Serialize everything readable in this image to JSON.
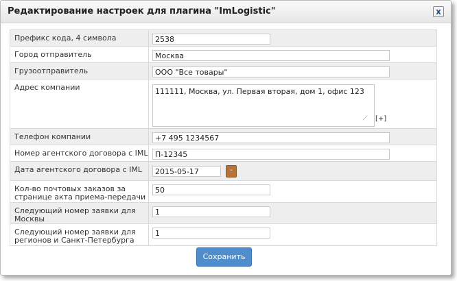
{
  "dialog": {
    "title": "Редактирование настроек для плагина \"ImLogistic\"",
    "close_label": "x"
  },
  "fields": {
    "prefix": {
      "label": "Префикс кода, 4 символа",
      "value": "2538"
    },
    "city": {
      "label": "Город отправитель",
      "value": "Москва"
    },
    "shipper": {
      "label": "Грузоотправитель",
      "value": "ООО \"Все товары\""
    },
    "address": {
      "label": "Адрес компании",
      "value": "111111, Москва, ул. Первая вторая, дом 1, офис 123",
      "expand_label": "[+]"
    },
    "phone": {
      "label": "Телефон компании",
      "value": "+7 495 1234567"
    },
    "contract_number": {
      "label": "Номер агентского договора с IML",
      "value": "П-12345"
    },
    "contract_date": {
      "label": "Дата агентского договора с IML",
      "value": "2015-05-17",
      "calendar_label": "-"
    },
    "orders_per_page": {
      "label": "Кол-во почтовых заказов за странице акта приема-передачи",
      "value": "50"
    },
    "next_moscow": {
      "label": "Следующий номер заявки для Москвы",
      "value": "1"
    },
    "next_regions": {
      "label": "Следующий номер заявки для регионов и Санкт-Петербурга",
      "value": "1"
    }
  },
  "save_label": "Сохранить"
}
